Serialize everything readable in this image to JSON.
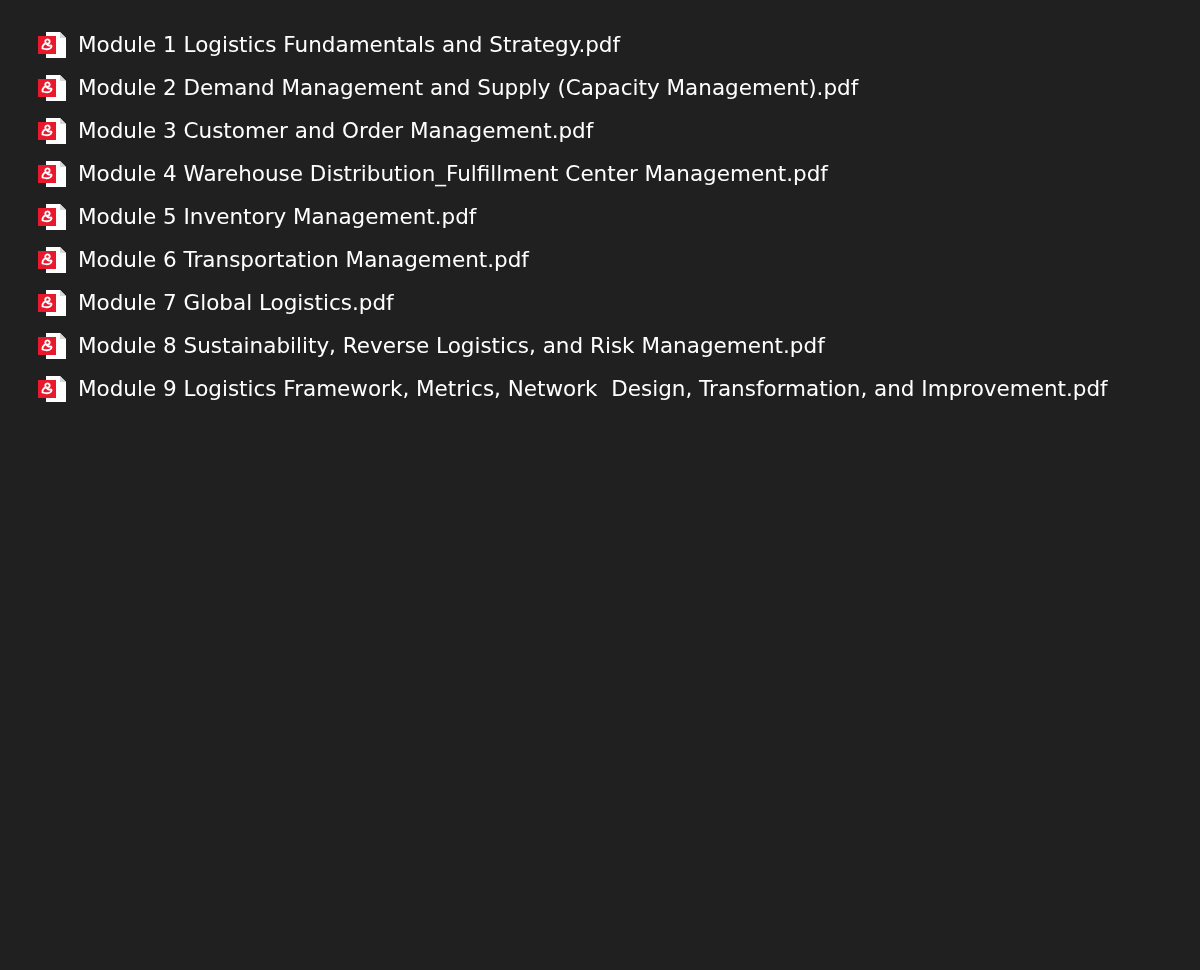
{
  "files": [
    {
      "name": "Module 1 Logistics Fundamentals and Strategy.pdf"
    },
    {
      "name": "Module 2 Demand Management and Supply (Capacity Management).pdf"
    },
    {
      "name": "Module 3 Customer and Order Management.pdf"
    },
    {
      "name": "Module 4 Warehouse Distribution_Fulfillment Center Management.pdf"
    },
    {
      "name": "Module 5 Inventory Management.pdf"
    },
    {
      "name": "Module 6 Transportation Management.pdf"
    },
    {
      "name": "Module 7 Global Logistics.pdf"
    },
    {
      "name": "Module 8 Sustainability, Reverse Logistics, and Risk Management.pdf"
    },
    {
      "name": "Module 9 Logistics Framework, Metrics, Network  Design, Transformation, and Improvement.pdf"
    }
  ]
}
